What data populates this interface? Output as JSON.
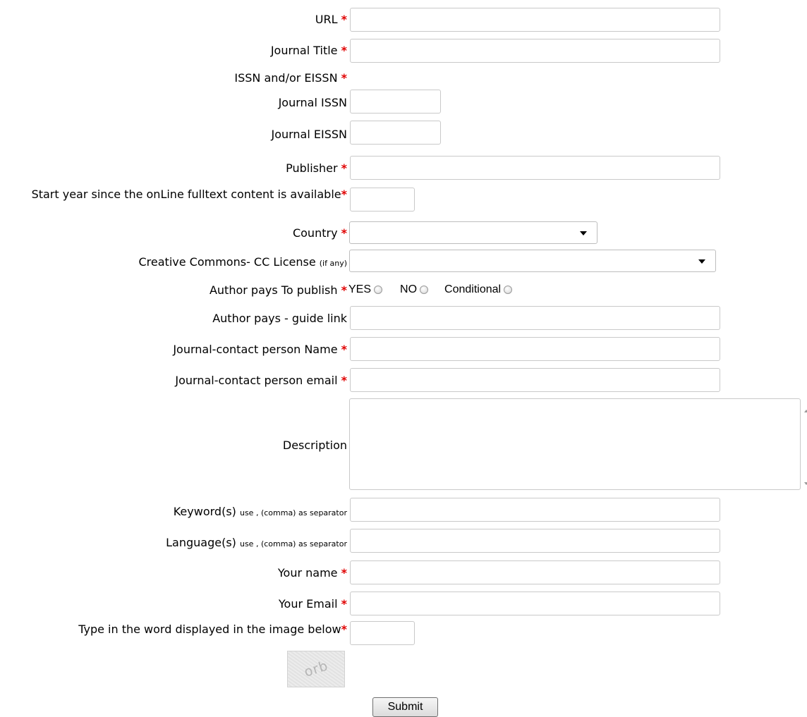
{
  "form": {
    "required_mark": "*",
    "url_label": "URL",
    "journal_title_label": "Journal Title",
    "issn_group_label": "ISSN and/or EISSN",
    "journal_issn_label": "Journal ISSN",
    "journal_eissn_label": "Journal EISSN",
    "publisher_label": "Publisher",
    "start_year_label": "Start year since the onLine fulltext content is available",
    "country_label": "Country",
    "country_selected": "",
    "cc_license_label": "Creative Commons- CC License",
    "cc_license_hint": "(if any)",
    "cc_license_selected": "",
    "author_pays_label": "Author pays To publish",
    "author_pays_options": [
      "YES",
      "NO",
      "Conditional"
    ],
    "author_pays_guide_label": "Author pays - guide link",
    "contact_name_label": "Journal-contact person Name",
    "contact_email_label": "Journal-contact person email",
    "description_label": "Description",
    "keywords_label": "Keyword(s)",
    "keywords_hint": "use , (comma) as separator",
    "languages_label": "Language(s)",
    "languages_hint": "use , (comma) as separator",
    "your_name_label": "Your name",
    "your_email_label": "Your Email",
    "captcha_label": "Type in the word displayed in the image below",
    "captcha_word": "orb",
    "submit_label": "Submit"
  },
  "colors": {
    "required": "#e00000",
    "input_border": "#c9c9c9"
  }
}
